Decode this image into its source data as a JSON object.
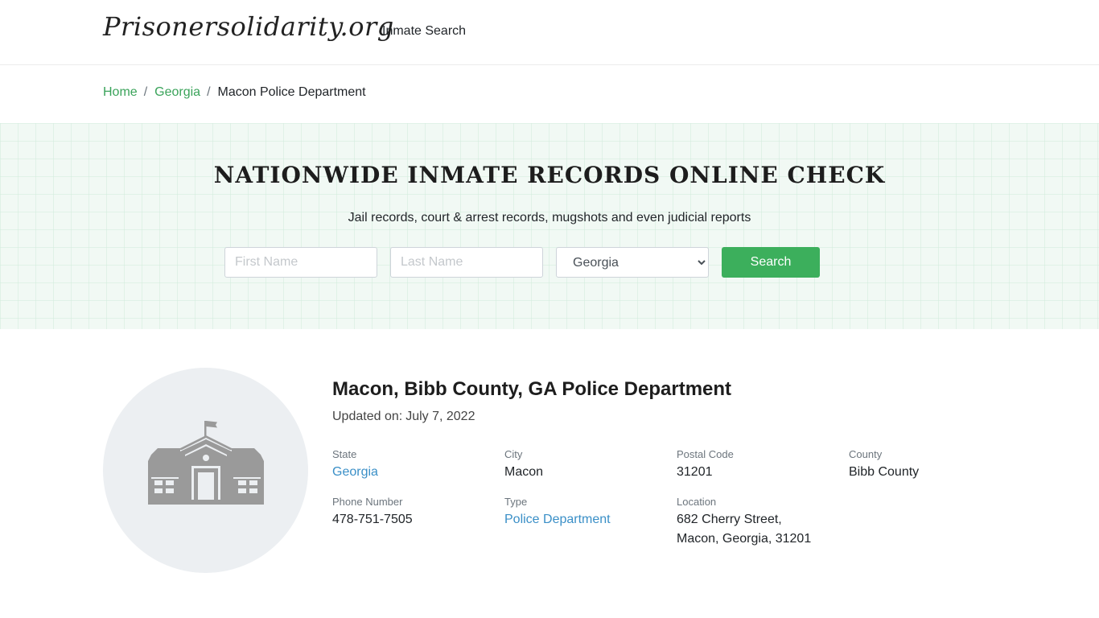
{
  "header": {
    "logo": "Prisonersolidarity.org",
    "nav_inmate_search": "Inmate Search"
  },
  "breadcrumb": {
    "home": "Home",
    "state": "Georgia",
    "current": "Macon Police Department",
    "separator": "/"
  },
  "hero": {
    "title": "NATIONWIDE INMATE RECORDS ONLINE CHECK",
    "subtitle": "Jail records, court & arrest records, mugshots and even judicial reports",
    "first_name_placeholder": "First Name",
    "last_name_placeholder": "Last Name",
    "state_selected": "Georgia",
    "search_label": "Search"
  },
  "department": {
    "title": "Macon, Bibb County, GA Police Department",
    "updated_label": "Updated on:",
    "updated_date": "July 7, 2022",
    "icon": "building-icon",
    "fields": {
      "state_label": "State",
      "state_value": "Georgia",
      "city_label": "City",
      "city_value": "Macon",
      "postal_label": "Postal Code",
      "postal_value": "31201",
      "county_label": "County",
      "county_value": "Bibb County",
      "phone_label": "Phone Number",
      "phone_value": "478-751-7505",
      "type_label": "Type",
      "type_value": "Police Department",
      "location_label": "Location",
      "location_line1": "682 Cherry Street,",
      "location_line2": "Macon, Georgia, 31201"
    }
  },
  "colors": {
    "accent_green": "#3caf5c",
    "link_green": "#3aa35a",
    "link_blue": "#3a8fc7"
  }
}
